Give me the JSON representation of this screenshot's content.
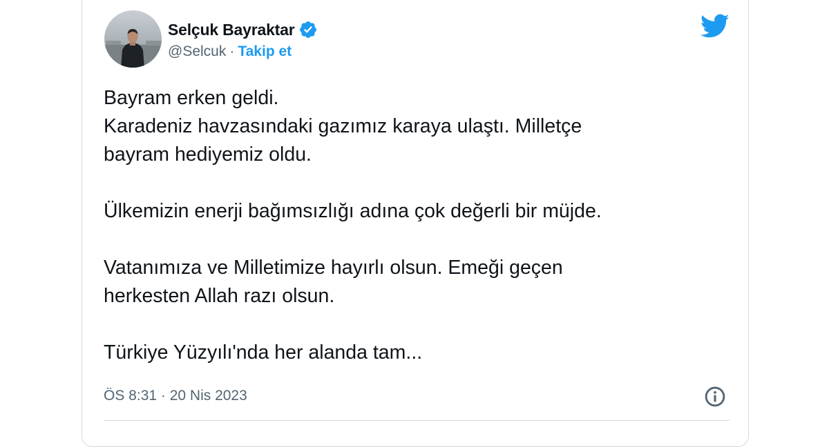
{
  "author": {
    "display_name": "Selçuk Bayraktar",
    "handle": "@Selcuk",
    "separator": "·",
    "follow_label": "Takip et",
    "verified": true
  },
  "tweet": {
    "lines": [
      "Bayram erken geldi.",
      "Karadeniz havzasındaki gazımız karaya ulaştı. Milletçe",
      "bayram hediyemiz oldu.",
      "",
      "Ülkemizin enerji bağımsızlığı adına çok değerli bir müjde.",
      "",
      "Vatanımıza ve Milletimize hayırlı olsun. Emeği geçen",
      "herkesten Allah razı olsun.",
      "",
      "Türkiye Yüzyılı'nda her alanda tam..."
    ],
    "timestamp": "ÖS 8:31 · 20 Nis 2023"
  },
  "icons": {
    "brand": "twitter-bird-icon",
    "verified": "verified-badge-icon",
    "info": "info-icon"
  },
  "colors": {
    "accent": "#1d9bf0",
    "text": "#0f1419",
    "secondary": "#536471",
    "border": "#cfd9de"
  }
}
